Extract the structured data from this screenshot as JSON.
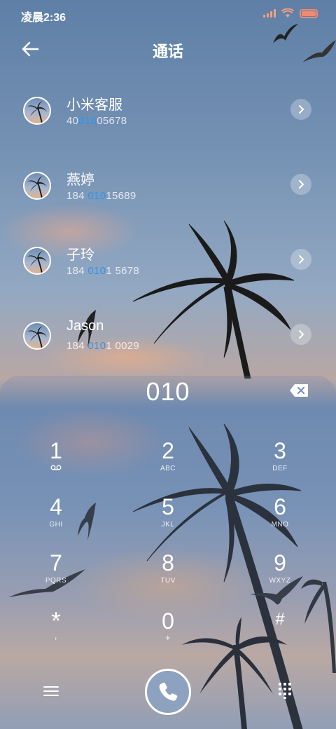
{
  "status": {
    "time": "凌晨2:36"
  },
  "header": {
    "title": "通话"
  },
  "contacts": [
    {
      "name": "小米客服",
      "num_pre": "40",
      "num_hl": "010",
      "num_post": "05678"
    },
    {
      "name": "燕婷",
      "num_pre": "184 ",
      "num_hl": "010",
      "num_post": "15689"
    },
    {
      "name": "子玲",
      "num_pre": "184 ",
      "num_hl": "010",
      "num_post": "1 5678"
    },
    {
      "name": "Jason",
      "num_pre": "184 ",
      "num_hl": "010",
      "num_post": "1 0029"
    }
  ],
  "dialer": {
    "input": "010",
    "keys": [
      {
        "digit": "1",
        "letters": ""
      },
      {
        "digit": "2",
        "letters": "ABC"
      },
      {
        "digit": "3",
        "letters": "DEF"
      },
      {
        "digit": "4",
        "letters": "GHI"
      },
      {
        "digit": "5",
        "letters": "JKL"
      },
      {
        "digit": "6",
        "letters": "MNO"
      },
      {
        "digit": "7",
        "letters": "PQRS"
      },
      {
        "digit": "8",
        "letters": "TUV"
      },
      {
        "digit": "9",
        "letters": "WXYZ"
      },
      {
        "digit": "*",
        "letters": ","
      },
      {
        "digit": "0",
        "letters": "+"
      },
      {
        "digit": "#",
        "letters": ""
      }
    ]
  },
  "colors": {
    "highlight": "#2e95f0",
    "call_button": "#8da2c0",
    "battery": "#f08a70"
  },
  "icons": {
    "back": "arrow-left-icon",
    "chevron": "chevron-right-icon",
    "backspace": "backspace-icon",
    "voicemail": "voicemail-icon",
    "menu": "menu-icon",
    "call": "phone-icon",
    "keypad": "keypad-icon"
  }
}
